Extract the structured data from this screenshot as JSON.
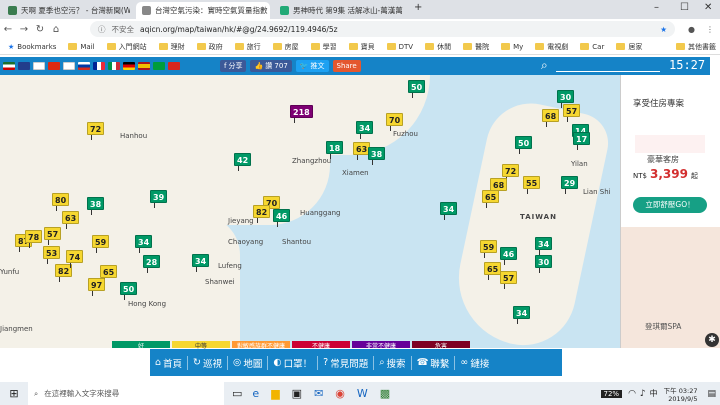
{
  "browser": {
    "tabs": [
      {
        "title": "天啊 夏季也空污？ - 台灣新聞(W",
        "color": "#3a7c4f",
        "active": false
      },
      {
        "title": "台灣空氣污染：實時空氣質量指數",
        "color": "#888",
        "active": true
      },
      {
        "title": "男神時代 第9集 活解冰山-萬漢萬",
        "color": "#2a7",
        "active": false
      }
    ],
    "security": "不安全",
    "url": "aqicn.org/map/taiwan/hk/#@g/24.9692/119.4946/5z",
    "bookmarks": [
      "Bookmarks",
      "Mail",
      "入門網站",
      "理財",
      "政府",
      "旅行",
      "房屋",
      "學習",
      "寶貝",
      "DTV",
      "休閒",
      "醫院",
      "My",
      "電視劇",
      "Car",
      "居家",
      "其他書籤"
    ]
  },
  "site": {
    "share_fb": "分享",
    "like_fb": "讚 707",
    "tweet": "推文",
    "share": "Share",
    "clock": "15:27",
    "legend": [
      "好",
      "中等",
      "對敏感族群不健康",
      "不健康",
      "非常不健康",
      "危害"
    ],
    "nav": [
      "首頁",
      "巡視",
      "地圖",
      "口罩！",
      "常見問題",
      "搜索",
      "聯繫",
      "鏈接"
    ]
  },
  "map": {
    "cities": [
      "Zhangzhou",
      "Xiamen",
      "Huanggang",
      "Jieyang",
      "Chaoyang",
      "Shantou",
      "Lufeng",
      "Shanwei",
      "Hong Kong",
      "Jiangmen",
      "Fuzhou",
      "Yunfu",
      "TAIWAN",
      "Lian Shi",
      "Yilan",
      "Hanhou"
    ],
    "markers": [
      {
        "v": "218",
        "c": "#7e0073"
      },
      {
        "v": "70",
        "c": "#f6d730"
      },
      {
        "v": "50",
        "c": "#009966"
      },
      {
        "v": "72",
        "c": "#f6d730"
      },
      {
        "v": "34",
        "c": "#009966"
      },
      {
        "v": "18",
        "c": "#009966"
      },
      {
        "v": "63",
        "c": "#f6d730"
      },
      {
        "v": "38",
        "c": "#009966"
      },
      {
        "v": "42",
        "c": "#009966"
      },
      {
        "v": "39",
        "c": "#009966"
      },
      {
        "v": "80",
        "c": "#f6d730"
      },
      {
        "v": "38",
        "c": "#009966"
      },
      {
        "v": "63",
        "c": "#f6d730"
      },
      {
        "v": "57",
        "c": "#f6d730"
      },
      {
        "v": "87",
        "c": "#f6d730"
      },
      {
        "v": "78",
        "c": "#f6d730"
      },
      {
        "v": "59",
        "c": "#f6d730"
      },
      {
        "v": "82",
        "c": "#f6d730"
      },
      {
        "v": "74",
        "c": "#f6d730"
      },
      {
        "v": "65",
        "c": "#f6d730"
      },
      {
        "v": "97",
        "c": "#f6d730"
      },
      {
        "v": "50",
        "c": "#009966"
      },
      {
        "v": "53",
        "c": "#f6d730"
      },
      {
        "v": "28",
        "c": "#009966"
      },
      {
        "v": "34",
        "c": "#009966"
      },
      {
        "v": "70",
        "c": "#f6d730"
      },
      {
        "v": "82",
        "c": "#f6d730"
      },
      {
        "v": "46",
        "c": "#009966"
      },
      {
        "v": "34",
        "c": "#009966"
      },
      {
        "v": "34",
        "c": "#009966"
      },
      {
        "v": "30",
        "c": "#009966"
      },
      {
        "v": "68",
        "c": "#f6d730"
      },
      {
        "v": "57",
        "c": "#f6d730"
      },
      {
        "v": "14",
        "c": "#009966"
      },
      {
        "v": "17",
        "c": "#009966"
      },
      {
        "v": "50",
        "c": "#009966"
      },
      {
        "v": "72",
        "c": "#f6d730"
      },
      {
        "v": "68",
        "c": "#f6d730"
      },
      {
        "v": "55",
        "c": "#f6d730"
      },
      {
        "v": "29",
        "c": "#009966"
      },
      {
        "v": "65",
        "c": "#f6d730"
      },
      {
        "v": "59",
        "c": "#f6d730"
      },
      {
        "v": "46",
        "c": "#009966"
      },
      {
        "v": "34",
        "c": "#009966"
      },
      {
        "v": "30",
        "c": "#009966"
      },
      {
        "v": "65",
        "c": "#f6d730"
      },
      {
        "v": "57",
        "c": "#f6d730"
      },
      {
        "v": "34",
        "c": "#009966"
      }
    ]
  },
  "ad": {
    "title": "享受住房專案",
    "line1": "豪華客房",
    "price_label": "NT$",
    "price": "3,399",
    "price_suffix": "起",
    "button": "立即舒壓GO！",
    "brand": "登琪爾SPA"
  },
  "taskbar": {
    "search": "在這裡輸入文字來搜尋",
    "time": "下午 03:27",
    "date": "2019/9/5",
    "battery": "72%"
  }
}
